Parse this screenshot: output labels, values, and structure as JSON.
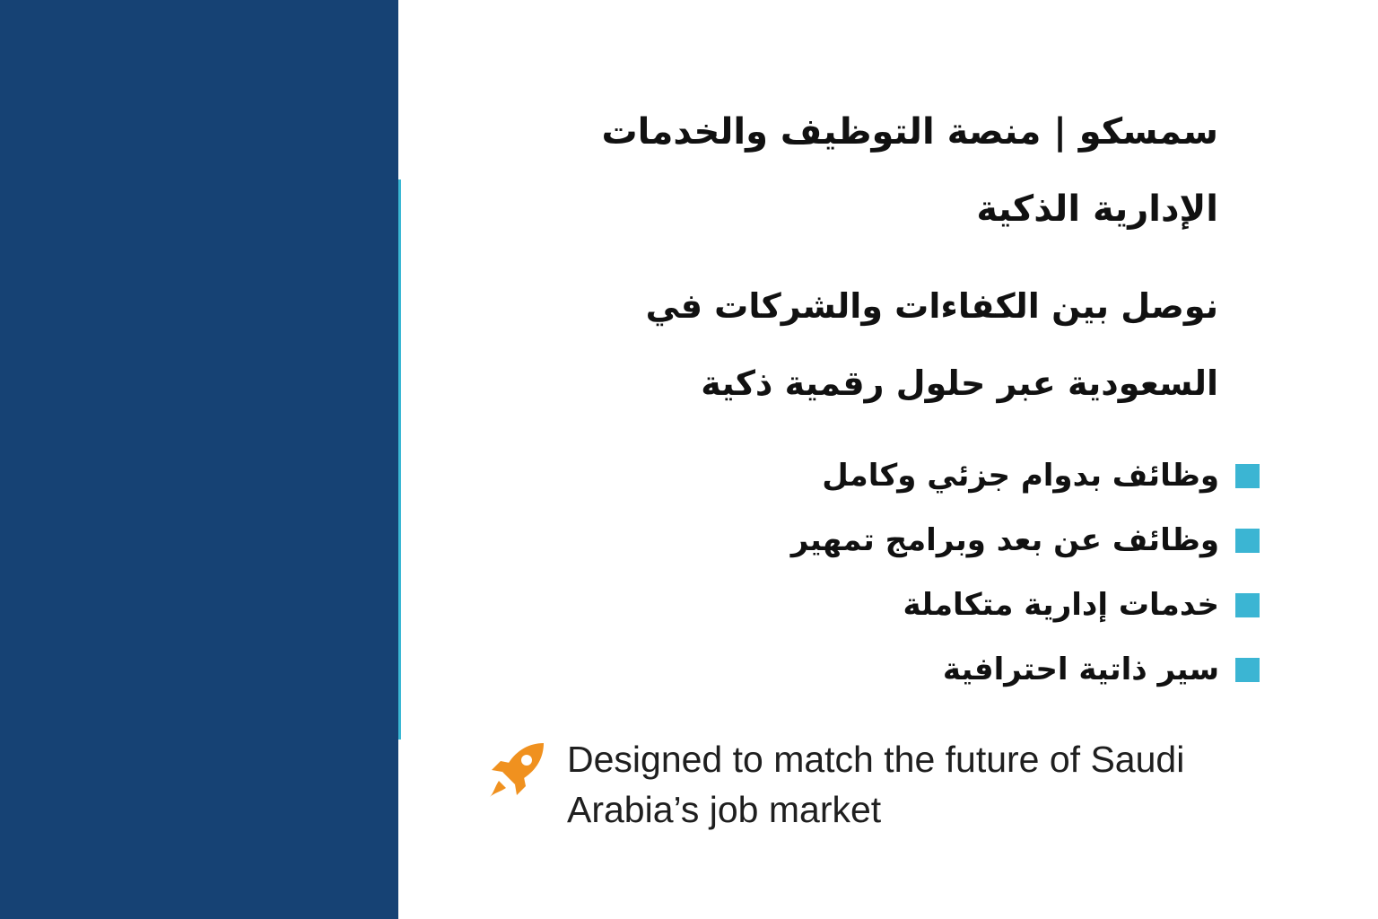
{
  "title": "سمسكو | منصة التوظيف والخدمات الإدارية الذكية",
  "subtitle": "نوصل بين الكفاءات والشركات في السعودية عبر حلول رقمية ذكية",
  "features": [
    {
      "label": "وظائف بدوام جزئي وكامل"
    },
    {
      "label": "وظائف عن بعد وبرامج تمهير"
    },
    {
      "label": "خدمات إدارية متكاملة"
    },
    {
      "label": "سير ذاتية احترافية"
    }
  ],
  "footer": {
    "text": "Designed to match the future of Saudi Arabia’s job market",
    "icon": "rocket-icon"
  },
  "colors": {
    "panel": "#164274",
    "accent": "#3bb5d3",
    "rocket": "#f0911f"
  }
}
